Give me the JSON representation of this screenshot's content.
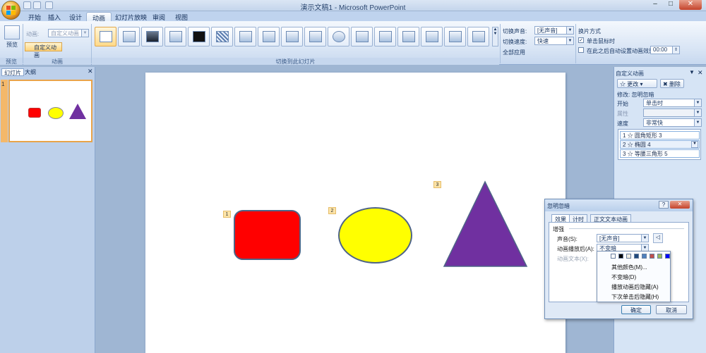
{
  "window": {
    "title": "演示文稿1 - Microsoft PowerPoint"
  },
  "tabs": [
    {
      "label": "开始"
    },
    {
      "label": "插入"
    },
    {
      "label": "设计"
    },
    {
      "label": "动画"
    },
    {
      "label": "幻灯片放映"
    },
    {
      "label": "审阅"
    },
    {
      "label": "视图"
    }
  ],
  "ribbon": {
    "preview_label": "预览",
    "preview_group": "预览",
    "animation_label": "动画:",
    "animation_value": "自定义动画",
    "custom_anim_button": "自定义动画",
    "animation_group": "动画",
    "transitions_group": "切换到此幻灯片",
    "transition_sound_label": "切换声音:",
    "transition_sound_value": "[无声音]",
    "transition_speed_label": "切换速度:",
    "transition_speed_value": "快速",
    "apply_all": "全部应用",
    "advance_title": "换片方式",
    "advance_on_click": "单击鼠标时",
    "advance_auto": "在此之后自动设置动画效果:",
    "advance_time": "00:00"
  },
  "left_pane": {
    "tab_slides": "幻灯片",
    "tab_outline": "大纲",
    "slide_number": "1"
  },
  "slide": {
    "tags": [
      "1",
      "2",
      "3"
    ]
  },
  "right_pane": {
    "title": "自定义动画",
    "change_button": "更改",
    "delete_button": "删除",
    "modify_label": "修改: 忽明忽暗",
    "start_label": "开始",
    "start_value": "单击时",
    "property_label": "属性",
    "speed_label": "速度",
    "speed_value": "非常快",
    "items": [
      {
        "num": "1",
        "name": "圆角矩形 3"
      },
      {
        "num": "2",
        "name": "椭圆 4"
      },
      {
        "num": "3",
        "name": "等腰三角形 5"
      }
    ]
  },
  "dialog": {
    "title": "忽明忽暗",
    "tabs": [
      "效果",
      "计时",
      "正文文本动画"
    ],
    "section": "增强",
    "sound_label": "声音(S):",
    "sound_value": "[无声音]",
    "after_label": "动画播放后(A):",
    "after_value": "不变暗",
    "text_label": "动画文本(X):",
    "menu": [
      "其他颜色(M)...",
      "不变暗(D)",
      "播放动画后隐藏(A)",
      "下次单击后隐藏(H)"
    ],
    "ok": "确定",
    "cancel": "取消"
  },
  "colors": {
    "rect": "#ff0000",
    "ellipse": "#ffff00",
    "triangle": "#7030a0",
    "swatches": [
      "#ffffff",
      "#000000",
      "#eeece1",
      "#1f497d",
      "#4f81bd",
      "#c0504d",
      "#9bbb59",
      "#0000ff",
      "#7030a0"
    ]
  }
}
